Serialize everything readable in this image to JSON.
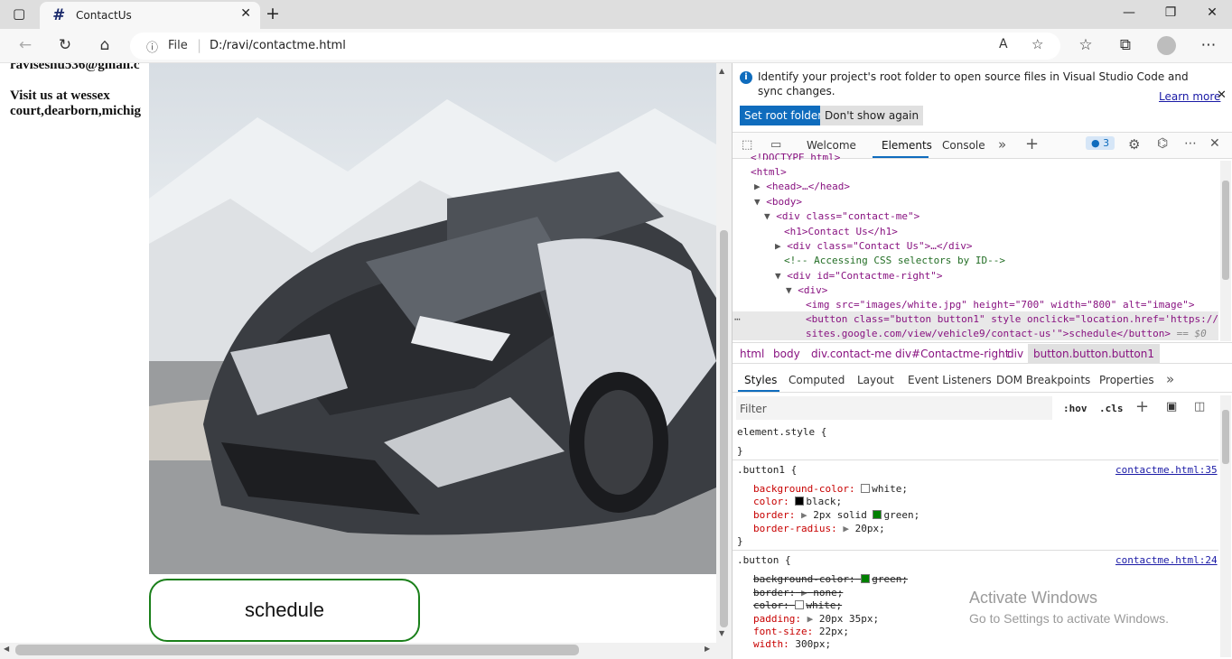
{
  "browser": {
    "tab_title": "ContactUs",
    "tab_icon": "#",
    "url_scheme": "File",
    "url": "D:/ravi/contactme.html"
  },
  "page": {
    "email_partial": "ravisesnu536@gmail.c",
    "visit_line1": "Visit us at wessex",
    "visit_line2": "court,dearborn,michig",
    "button_label": "schedule"
  },
  "devtools": {
    "banner_text_1": "Identify your project's root folder to open source files in Visual Studio Code and",
    "banner_text_2": "sync changes.",
    "learn_more": "Learn more",
    "set_root": "Set root folder",
    "dont_show": "Don't show again",
    "tabs": [
      "Welcome",
      "Elements",
      "Console"
    ],
    "issues_count": "3",
    "dom_lines": [
      "<!DOCTYPE html>",
      "<html>",
      "<head>…</head>",
      "<body>",
      "<div class=\"contact-me\">",
      "<h1>Contact Us</h1>",
      "<div class=\"Contact Us\">…</div>",
      "<!-- Accessing CSS selectors by ID-->",
      "<div id=\"Contactme-right\">",
      "<div>",
      "<img src=\"images/white.jpg\" height=\"700\" width=\"800\" alt=\"image\">",
      "<button class=\"button button1\" style onclick=\"location.href='https://",
      "sites.google.com/view/vehicle9/contact-us'\">schedule</button>",
      "== $0"
    ],
    "breadcrumb": [
      "html",
      "body",
      "div.contact-me",
      "div#Contactme-right",
      "div",
      "button.button.button1"
    ],
    "subtabs": [
      "Styles",
      "Computed",
      "Layout",
      "Event Listeners",
      "DOM Breakpoints",
      "Properties"
    ],
    "filter_placeholder": "Filter",
    "hov": ":hov",
    "cls": ".cls",
    "element_style": "element.style {",
    "close_brace": "}",
    "rule1": {
      "selector": ".button1 {",
      "source": "contactme.html:35",
      "props": [
        "background-color:",
        "white;",
        "color:",
        "black;",
        "border:",
        "2px solid",
        "green;",
        "border-radius:",
        "20px;"
      ]
    },
    "rule2": {
      "selector": ".button {",
      "source": "contactme.html:24",
      "props": [
        "background-color:",
        "green;",
        "border:",
        "none;",
        "color:",
        "white;",
        "padding:",
        "20px 35px;",
        "font-size:",
        "22px;",
        "width:",
        "300px;"
      ]
    },
    "watermark_1": "Activate Windows",
    "watermark_2": "Go to Settings to activate Windows."
  }
}
